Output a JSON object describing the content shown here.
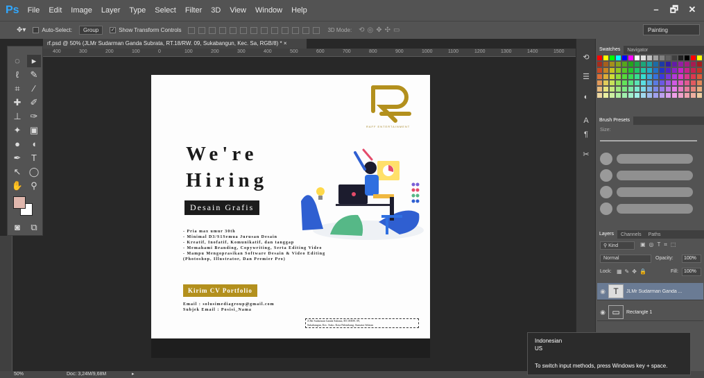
{
  "app": {
    "logo": "Ps",
    "menu": [
      "File",
      "Edit",
      "Image",
      "Layer",
      "Type",
      "Select",
      "Filter",
      "3D",
      "View",
      "Window",
      "Help"
    ],
    "window_controls": [
      "–",
      "🗗",
      "✕"
    ]
  },
  "options_bar": {
    "auto_select_label": "Auto-Select:",
    "auto_select_value": "Group",
    "show_transform_label": "Show Transform Controls",
    "mode_3d_label": "3D Mode:",
    "workspace": "Painting"
  },
  "document": {
    "tab_title": "rf.psd @ 50% (JLMr Sudarman Ganda Subrata, RT.18/RW. 09, Sukabangun, Kec. Sa, RGB/8) *",
    "ruler_ticks": [
      "400",
      "300",
      "200",
      "100",
      "0",
      "100",
      "200",
      "300",
      "400",
      "500",
      "600",
      "700",
      "800",
      "900",
      "1000",
      "1100",
      "1200",
      "1300",
      "1400",
      "1500"
    ]
  },
  "poster": {
    "logo_caption": "RAFF ENTERTAINMENT",
    "headline_line1": "We're",
    "headline_line2": "Hiring",
    "role": "Desain Grafis",
    "requirements": [
      "- Pria max umur 30th",
      "- Minimal D3/S1Semua Jurusan Desain",
      "- Kreatif, Inofatif, Komunikatif, dan tanggap",
      "- Memahami Branding, Copywriting, Serta Editing Video",
      "- Mampu Mengoprasikan Software Desain & Video Editing",
      "  (Photoshop, Illustrator, Dan Premier Pro)"
    ],
    "cta": "Kirim CV Portfolio",
    "email_line": "Email : solusimediagroup@gmail.com",
    "subject_line": "Subjek Email : Posisi_Nama",
    "address_line1": "Jl.Mr Sudarman Ganda Subrata, RT.18/RW. 09,",
    "address_line2": "Sukabangun, Kec. Suko, Kota Palembang, Sumatra Selatan"
  },
  "panels": {
    "swatches_tabs": [
      "Swatches",
      "Navigator"
    ],
    "brush_tabs": [
      "Brush Presets"
    ],
    "brush_size_label": "Size:",
    "layers_tabs": [
      "Layers",
      "Channels",
      "Paths"
    ],
    "filter_kind": "Kind",
    "blend_mode": "Normal",
    "opacity_label": "Opacity:",
    "opacity_value": "100%",
    "lock_label": "Lock:",
    "fill_label": "Fill:",
    "fill_value": "100%",
    "layers": [
      {
        "name": "JLMr Sudarman Ganda ...",
        "thumb": "T",
        "selected": true
      },
      {
        "name": "Rectangle 1",
        "thumb": "▭",
        "selected": false
      }
    ]
  },
  "status": {
    "zoom": "50%",
    "doc_info": "Doc: 3,24M/9,68M"
  },
  "ime_tooltip": {
    "language": "Indonesian",
    "layout": "US",
    "hint": "To switch input methods, press Windows key + space."
  },
  "colors": {
    "foreground": "#e0b7ad",
    "background": "#ffffff",
    "gold": "#b3901d",
    "brand_blue": "#31a8ff"
  }
}
